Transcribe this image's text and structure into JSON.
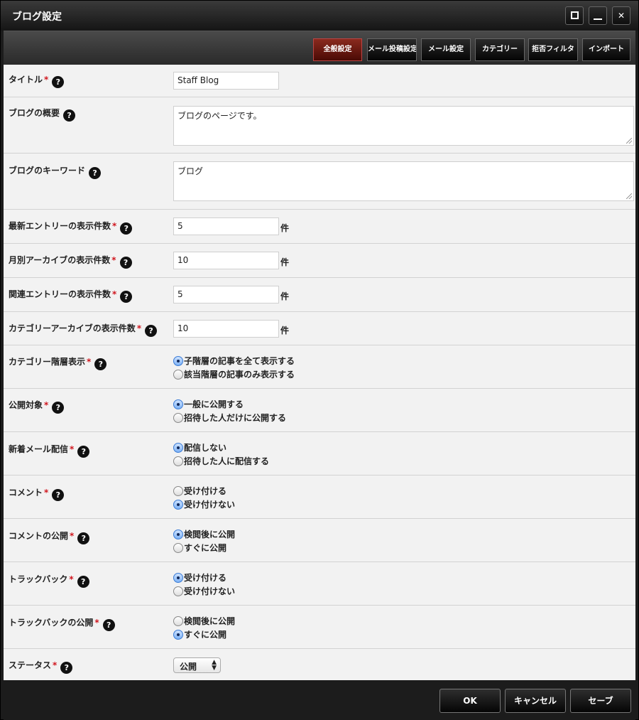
{
  "window": {
    "title": "ブログ設定"
  },
  "tabs": [
    {
      "label": "全般設定",
      "active": true
    },
    {
      "label": "メール投稿設定",
      "active": false
    },
    {
      "label": "メール設定",
      "active": false
    },
    {
      "label": "カテゴリー",
      "active": false
    },
    {
      "label": "拒否フィルタ",
      "active": false
    },
    {
      "label": "インポート",
      "active": false
    }
  ],
  "form": {
    "title": {
      "label": "タイトル",
      "value": "Staff Blog"
    },
    "summary": {
      "label": "ブログの概要",
      "value": "ブログのページです。"
    },
    "keywords": {
      "label": "ブログのキーワード",
      "value": "ブログ"
    },
    "latest_count": {
      "label": "最新エントリーの表示件数",
      "value": "5",
      "unit": "件"
    },
    "monthly_count": {
      "label": "月別アーカイブの表示件数",
      "value": "10",
      "unit": "件"
    },
    "related_count": {
      "label": "関連エントリーの表示件数",
      "value": "5",
      "unit": "件"
    },
    "category_archive_count": {
      "label": "カテゴリーアーカイブの表示件数",
      "value": "10",
      "unit": "件"
    },
    "category_hierarchy": {
      "label": "カテゴリー階層表示",
      "options": [
        "子階層の記事を全て表示する",
        "該当階層の記事のみ表示する"
      ],
      "selected": 0
    },
    "publish_target": {
      "label": "公開対象",
      "options": [
        "一般に公開する",
        "招待した人だけに公開する"
      ],
      "selected": 0
    },
    "new_mail": {
      "label": "新着メール配信",
      "options": [
        "配信しない",
        "招待した人に配信する"
      ],
      "selected": 0
    },
    "comment": {
      "label": "コメント",
      "options": [
        "受け付ける",
        "受け付けない"
      ],
      "selected": 1
    },
    "comment_publish": {
      "label": "コメントの公開",
      "options": [
        "検閲後に公開",
        "すぐに公開"
      ],
      "selected": 0
    },
    "trackback": {
      "label": "トラックバック",
      "options": [
        "受け付ける",
        "受け付けない"
      ],
      "selected": 0
    },
    "trackback_publish": {
      "label": "トラックバックの公開",
      "options": [
        "検閲後に公開",
        "すぐに公開"
      ],
      "selected": 1
    },
    "status": {
      "label": "ステータス",
      "value": "公開"
    }
  },
  "footer": {
    "ok": "OK",
    "cancel": "キャンセル",
    "save": "セーブ"
  },
  "icons": {
    "help": "?",
    "required": "*"
  }
}
